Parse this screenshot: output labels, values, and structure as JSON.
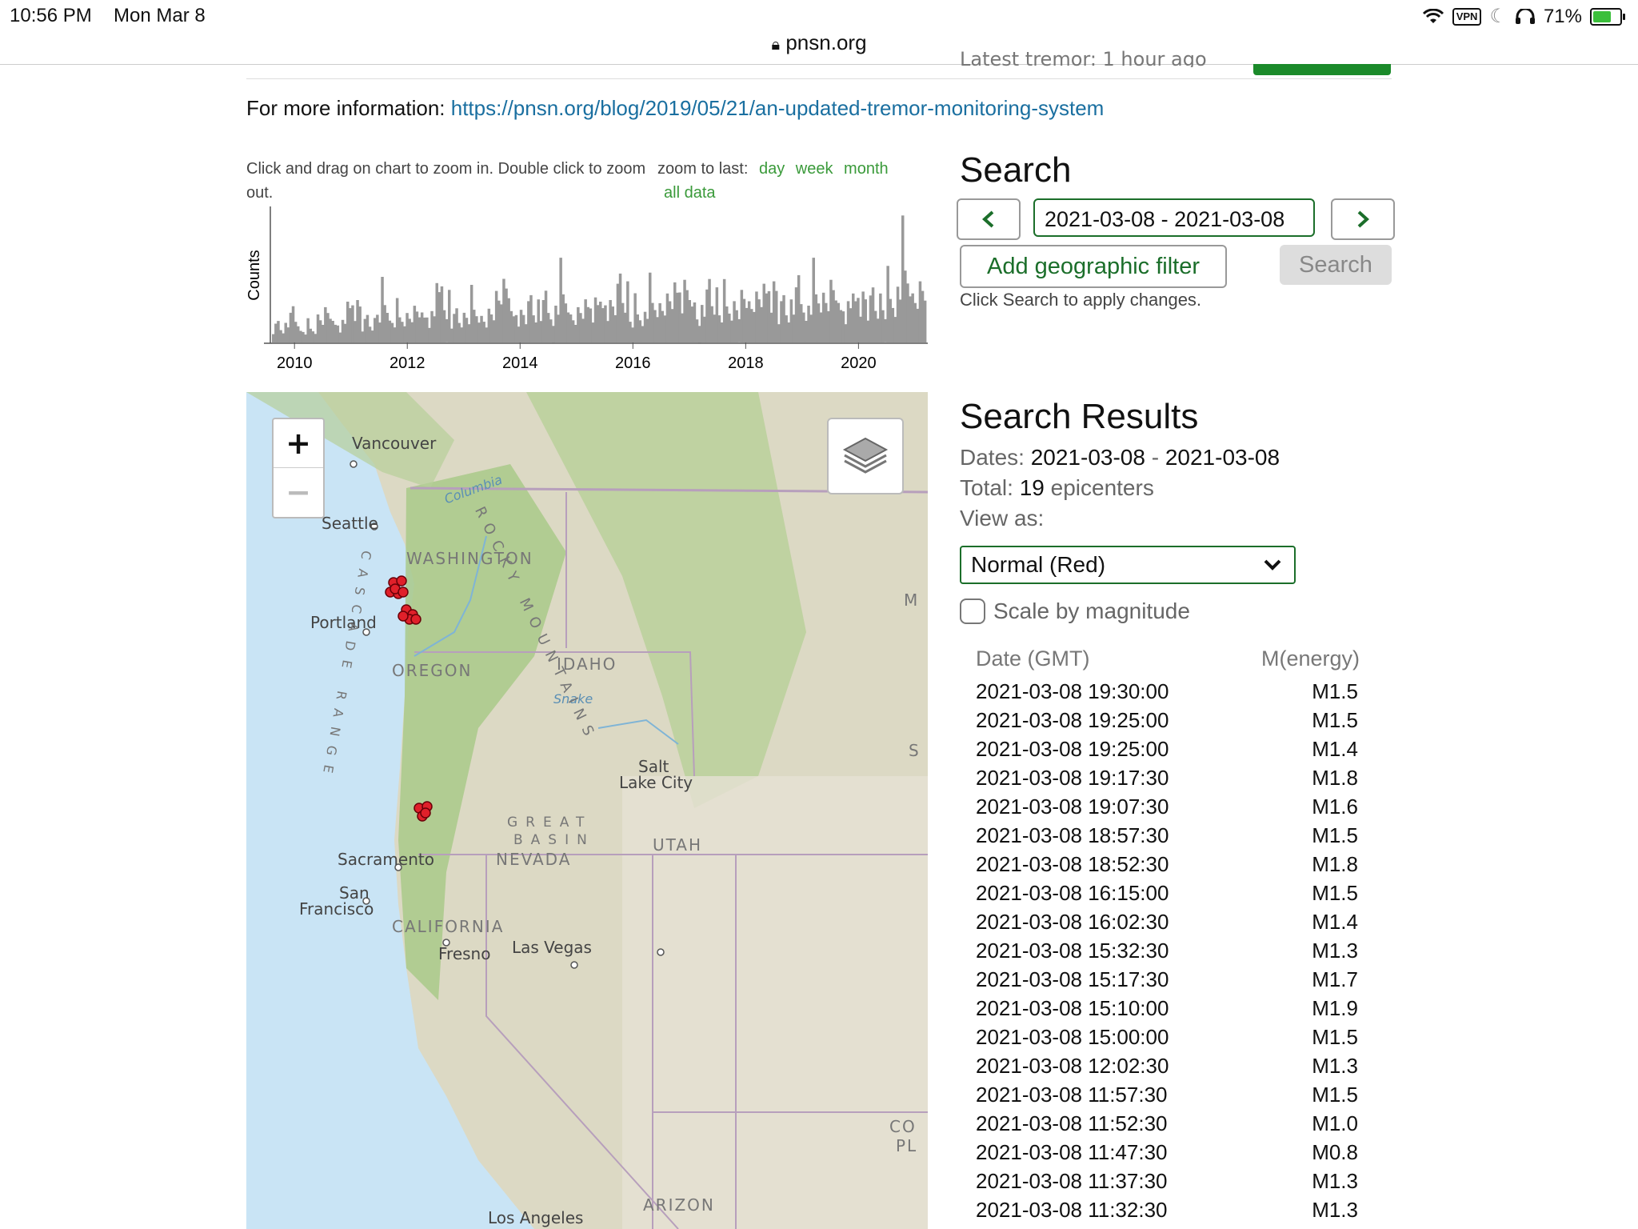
{
  "status": {
    "time": "10:56 PM",
    "date": "Mon Mar 8",
    "vpn": "VPN",
    "battery": "71%"
  },
  "browser": {
    "url": "pnsn.org"
  },
  "header": {
    "cut_text": "Latest tremor: 1 hour ago"
  },
  "info": {
    "label": "For more information: ",
    "link": "https://pnsn.org/blog/2019/05/21/an-updated-tremor-monitoring-system"
  },
  "chart": {
    "help": "Click and drag on chart to zoom in. Double click to zoom out.",
    "zoom_label": "zoom to last:",
    "zoom_links": [
      "day",
      "week",
      "month",
      "all data"
    ]
  },
  "chart_data": {
    "type": "area",
    "ylabel": "Counts",
    "xlabel": "",
    "x_ticks": [
      "2010",
      "2012",
      "2014",
      "2016",
      "2018",
      "2020"
    ],
    "xlim": [
      2009.6,
      2021.2
    ],
    "series": [
      {
        "values": [
          0.25,
          0.35,
          0.2,
          0.45,
          0.3,
          0.5,
          0.3,
          0.6,
          0.35,
          0.45,
          0.4,
          0.7,
          0.35,
          0.5,
          0.45,
          0.75,
          0.4,
          0.55,
          0.5,
          0.7,
          0.45,
          0.6,
          0.5,
          0.75,
          0.45,
          0.55,
          0.6,
          0.8,
          0.5,
          0.65,
          0.55,
          0.7,
          0.6,
          0.75,
          0.55,
          0.65,
          0.7,
          0.8,
          0.55,
          0.6,
          0.6,
          0.7,
          1.0,
          0.75
        ]
      }
    ],
    "color": "#999999"
  },
  "map": {
    "labels": [
      {
        "text": "Vancouver",
        "cls": "city"
      },
      {
        "text": "Seattle",
        "cls": "city"
      },
      {
        "text": "WASHINGTON",
        "cls": "state"
      },
      {
        "text": "Portland",
        "cls": "city"
      },
      {
        "text": "OREGON",
        "cls": "state"
      },
      {
        "text": "IDAHO",
        "cls": "state"
      },
      {
        "text": "Snake",
        "cls": "river"
      },
      {
        "text": "Salt",
        "cls": "city"
      },
      {
        "text": "Lake City",
        "cls": "city"
      },
      {
        "text": "GREAT",
        "cls": "region"
      },
      {
        "text": "BASIN",
        "cls": "region"
      },
      {
        "text": "NEVADA",
        "cls": "state"
      },
      {
        "text": "UTAH",
        "cls": "state"
      },
      {
        "text": "Sacramento",
        "cls": "city"
      },
      {
        "text": "San",
        "cls": "city"
      },
      {
        "text": "Francisco",
        "cls": "city"
      },
      {
        "text": "CALIFORNIA",
        "cls": "state"
      },
      {
        "text": "Fresno",
        "cls": "city"
      },
      {
        "text": "Las Vegas",
        "cls": "city"
      },
      {
        "text": "Los Angeles",
        "cls": "city"
      },
      {
        "text": "ARIZON",
        "cls": "state"
      },
      {
        "text": "CO",
        "cls": "state"
      },
      {
        "text": "PL",
        "cls": "state"
      },
      {
        "text": "M",
        "cls": "state"
      },
      {
        "text": "S",
        "cls": "state"
      },
      {
        "text": "Columbia",
        "cls": "river"
      },
      {
        "text": "ROCKY MOUNTAINS",
        "cls": "region"
      },
      {
        "text": "CASCADE RANGE",
        "cls": "region"
      }
    ],
    "zoom_in": "+",
    "zoom_out": "−"
  },
  "search": {
    "title": "Search",
    "date_range": "2021-03-08 - 2021-03-08",
    "geo_button": "Add geographic filter",
    "search_button": "Search",
    "note": "Click Search to apply changes."
  },
  "results": {
    "title": "Search Results",
    "dates_label": "Dates: ",
    "date_from": "2021-03-08",
    "date_sep": " - ",
    "date_to": "2021-03-08",
    "total_label": "Total: ",
    "total": "19",
    "total_suffix": " epicenters",
    "view_label": "View as:",
    "view_value": "Normal (Red)",
    "scale_label": "Scale by magnitude",
    "col_date": "Date (GMT)",
    "col_mag": "M(energy)",
    "rows": [
      {
        "date": "2021-03-08 19:30:00",
        "mag": "M1.5"
      },
      {
        "date": "2021-03-08 19:25:00",
        "mag": "M1.5"
      },
      {
        "date": "2021-03-08 19:25:00",
        "mag": "M1.4"
      },
      {
        "date": "2021-03-08 19:17:30",
        "mag": "M1.8"
      },
      {
        "date": "2021-03-08 19:07:30",
        "mag": "M1.6"
      },
      {
        "date": "2021-03-08 18:57:30",
        "mag": "M1.5"
      },
      {
        "date": "2021-03-08 18:52:30",
        "mag": "M1.8"
      },
      {
        "date": "2021-03-08 16:15:00",
        "mag": "M1.5"
      },
      {
        "date": "2021-03-08 16:02:30",
        "mag": "M1.4"
      },
      {
        "date": "2021-03-08 15:32:30",
        "mag": "M1.3"
      },
      {
        "date": "2021-03-08 15:17:30",
        "mag": "M1.7"
      },
      {
        "date": "2021-03-08 15:10:00",
        "mag": "M1.9"
      },
      {
        "date": "2021-03-08 15:00:00",
        "mag": "M1.5"
      },
      {
        "date": "2021-03-08 12:02:30",
        "mag": "M1.3"
      },
      {
        "date": "2021-03-08 11:57:30",
        "mag": "M1.5"
      },
      {
        "date": "2021-03-08 11:52:30",
        "mag": "M1.0"
      },
      {
        "date": "2021-03-08 11:47:30",
        "mag": "M0.8"
      },
      {
        "date": "2021-03-08 11:37:30",
        "mag": "M1.3"
      },
      {
        "date": "2021-03-08 11:32:30",
        "mag": "M1.3"
      }
    ]
  }
}
